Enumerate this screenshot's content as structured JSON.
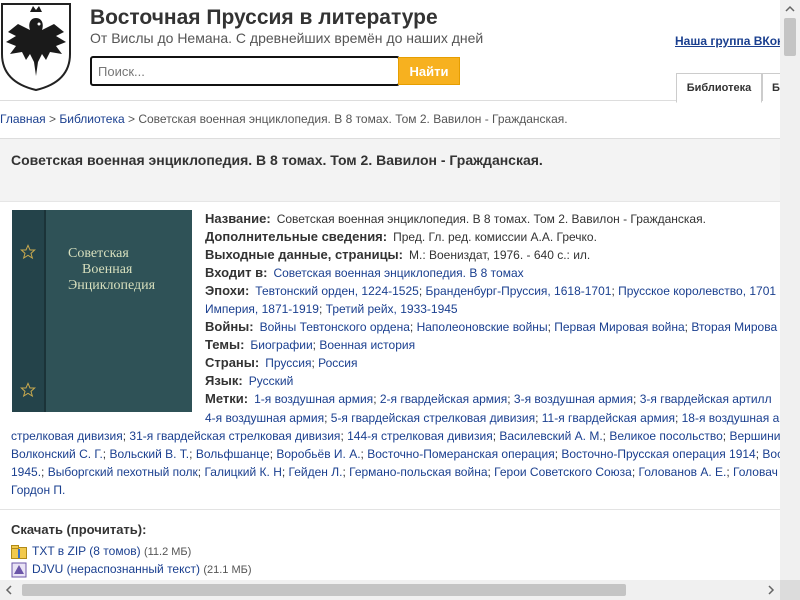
{
  "header": {
    "site_title": "Восточная Пруссия в литературе",
    "site_subtitle": "От Вислы до Немана. С древнейших времён до наших дней",
    "search_placeholder": "Поиск...",
    "search_button": "Найти",
    "vk_link": "Наша группа ВКонтакте",
    "tabs": [
      "Библиотека",
      "Б"
    ]
  },
  "breadcrumb": {
    "home": "Главная",
    "library": "Библиотека",
    "current": "Советская военная энциклопедия. В 8 томах. Том 2. Вавилон - Гражданская.",
    "sep": ">"
  },
  "page_title": "Советская военная энциклопедия. В 8 томах. Том 2. Вавилон - Гражданская.",
  "cover_text": [
    "Советская",
    "Военная",
    "Энциклопедия"
  ],
  "details": {
    "name_label": "Название:",
    "name_value": "Советская военная энциклопедия. В 8 томах. Том 2. Вавилон - Гражданская.",
    "extra_label": "Дополнительные сведения:",
    "extra_value": "Пред. Гл. ред. комиссии А.А. Гречко.",
    "output_label": "Выходные данные, страницы:",
    "output_value": "М.: Воениздат, 1976. - 640 с.: ил.",
    "part_of_label": "Входит в:",
    "part_of_value": "Советская военная энциклопедия. В 8 томах",
    "eras_label": "Эпохи:",
    "eras": [
      "Тевтонский орден, 1224-1525",
      "Бранденбург-Пруссия, 1618-1701",
      "Прусское королевство, 1701"
    ],
    "eras_line2": [
      "Империя, 1871-1919",
      "Третий рейх, 1933-1945"
    ],
    "wars_label": "Войны:",
    "wars": [
      "Войны Тевтонского ордена",
      "Наполеоновские войны",
      "Первая Мировая война",
      "Вторая Мирова"
    ],
    "themes_label": "Темы:",
    "themes": [
      "Биографии",
      "Военная история"
    ],
    "countries_label": "Страны:",
    "countries": [
      "Пруссия",
      "Россия"
    ],
    "language_label": "Язык:",
    "language_value": "Русский",
    "tags_label": "Метки:",
    "tags_line1": [
      "1-я воздушная армия",
      "2-я гвардейская армия",
      "3-я воздушная армия",
      "3-я гвардейская артилл"
    ],
    "tags_line2": [
      "4-я воздушная армия",
      "5-я гвардейская стрелковая дивизия",
      "11-я гвардейская армия",
      "18-я воздушная а"
    ],
    "tags_line3": [
      "стрелковая дивизия",
      "31-я гвардейская стрелковая дивизия",
      "144-я стрелковая дивизия",
      "Василевский А. М.",
      "Великое посольство",
      "Вершини"
    ],
    "tags_line4": [
      "Волконский С. Г.",
      "Вольский В. Т.",
      "Вольфшанце",
      "Воробьёв И. А.",
      "Восточно-Померанская операция",
      "Восточно-Прусская операция 1914",
      "Вос"
    ],
    "tags_line5": [
      "1945.",
      "Выборгский пехотный полк",
      "Галицкий К. Н",
      "Гейден Л.",
      "Германо-польская война",
      "Герои Советского Союза",
      "Голованов А. Е.",
      "Головач"
    ],
    "tags_line6": [
      "Гордон П."
    ]
  },
  "download": {
    "heading": "Скачать (прочитать):",
    "items": [
      {
        "label": "TXT в ZIP (8 томов)",
        "size": "(11.2 МБ)"
      },
      {
        "label": "DJVU (нераспознанный текст)",
        "size": "(21.1 МБ)"
      }
    ]
  },
  "colors": {
    "accent_button": "#f7b11f",
    "link": "#1a3f8f",
    "cover": "#2f5257"
  },
  "icons": {
    "logo": "prussian-eagle-icon",
    "zip": "zip-archive-icon",
    "djvu": "djvu-file-icon"
  }
}
